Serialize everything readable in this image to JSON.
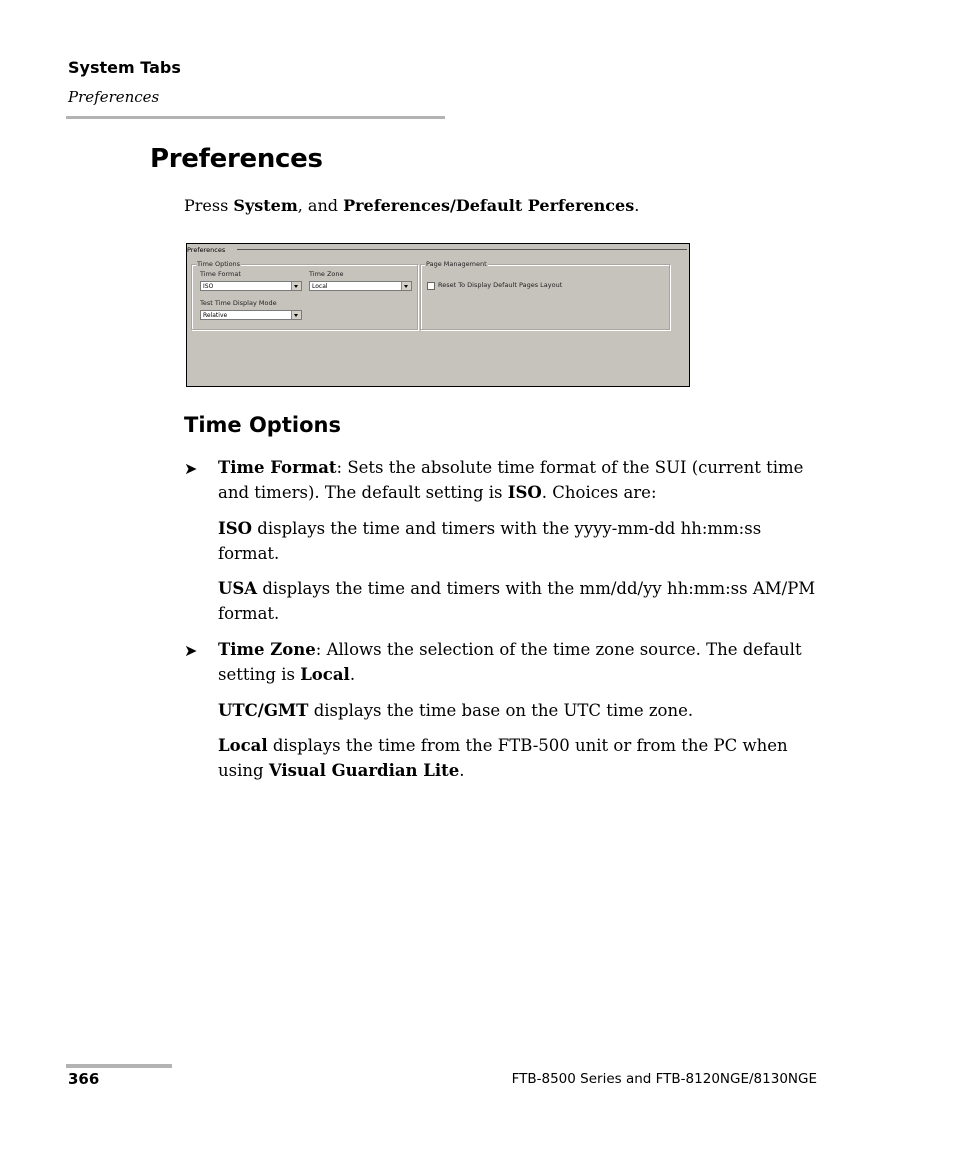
{
  "header": {
    "section": "System Tabs",
    "subsection": "Preferences"
  },
  "title": "Preferences",
  "intro": {
    "prefix": "Press ",
    "bold1": "System",
    "middle": ", and ",
    "bold2": "Preferences/Default Perferences",
    "suffix": "."
  },
  "screenshot": {
    "panel_title": "Preferences",
    "time_options": {
      "group_label": "Time Options",
      "time_format_label": "Time Format",
      "time_format_value": "ISO",
      "time_zone_label": "Time Zone",
      "time_zone_value": "Local",
      "display_mode_label": "Test Time Display Mode",
      "display_mode_value": "Relative"
    },
    "page_management": {
      "group_label": "Page Management",
      "reset_checkbox_label": "Reset To Display Default Pages Layout",
      "reset_checked": false
    }
  },
  "section_heading": "Time Options",
  "bullet_glyph": "➤",
  "items": [
    {
      "term": "Time Format",
      "text_line1": ": Sets the absolute time format of the SUI (current time",
      "text_line2_pre": "and timers). The default setting is ",
      "default_bold": "ISO",
      "text_line2_post": ". Choices are:",
      "choices": [
        {
          "term": "ISO",
          "line1": " displays the time and timers with the yyyy-mm-dd hh:mm:ss",
          "line2": "format."
        },
        {
          "term": "USA",
          "line1": " displays the time and timers with the mm/dd/yy hh:mm:ss AM/PM",
          "line2": "format."
        }
      ]
    },
    {
      "term": "Time Zone",
      "text_line1": ": Allows the selection of the time zone source. The default",
      "text_line2_pre": "setting is ",
      "default_bold": "Local",
      "text_line2_post": ".",
      "choices": [
        {
          "term": "UTC/GMT",
          "line1": " displays the time base on the UTC time zone.",
          "line2": ""
        },
        {
          "term": "Local",
          "line1": " displays the time from the FTB-500 unit or from the PC when",
          "line2_pre": "using ",
          "line2_bold": "Visual Guardian Lite",
          "line2_post": "."
        }
      ]
    }
  ],
  "footer": {
    "page_number": "366",
    "product": "FTB-8500 Series and FTB-8120NGE/8130NGE"
  }
}
